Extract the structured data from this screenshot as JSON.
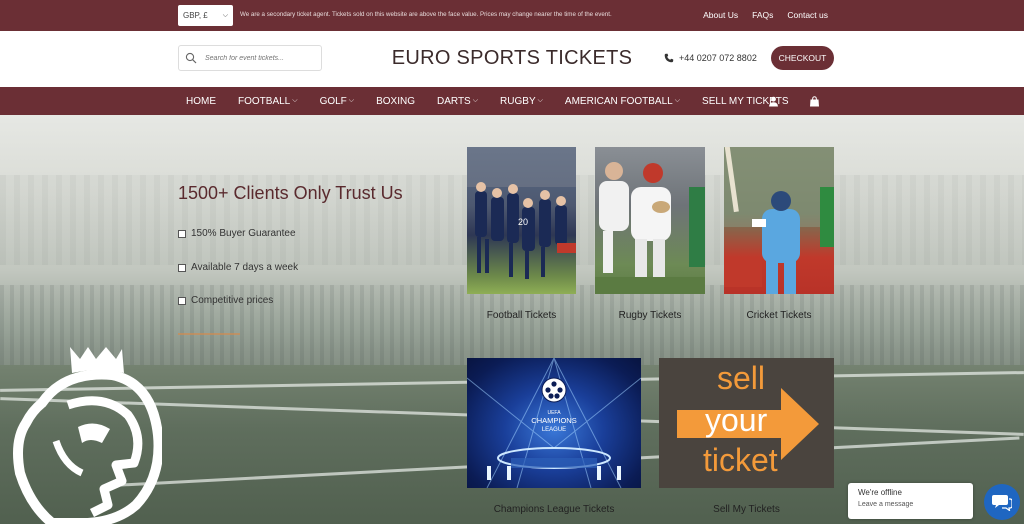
{
  "topbar": {
    "currency": "GBP, £",
    "notice": "We are a secondary ticket agent. Tickets sold on this website are above the face value. Prices may change nearer the time of the event.",
    "links": [
      "About Us",
      "FAQs",
      "Contact us"
    ]
  },
  "header": {
    "search_placeholder": "Search for event tickets...",
    "brand": "EURO SPORTS TICKETS",
    "phone": "+44 0207 072 8802",
    "checkout": "CHECKOUT"
  },
  "nav": {
    "items": [
      {
        "label": "HOME",
        "dropdown": false
      },
      {
        "label": "FOOTBALL",
        "dropdown": true
      },
      {
        "label": "GOLF",
        "dropdown": true
      },
      {
        "label": "BOXING",
        "dropdown": false
      },
      {
        "label": "DARTS",
        "dropdown": true
      },
      {
        "label": "RUGBY",
        "dropdown": true
      },
      {
        "label": "AMERICAN FOOTBALL",
        "dropdown": true
      },
      {
        "label": "SELL MY TICKETS",
        "dropdown": false
      }
    ],
    "icons": [
      "user-icon",
      "shopping-bag-icon"
    ]
  },
  "hero": {
    "title": "1500+ Clients Only Trust Us",
    "bullets": [
      "150% Buyer Guarantee",
      "Available 7 days a week",
      "Competitive prices"
    ]
  },
  "cards": [
    {
      "label": "Football Tickets"
    },
    {
      "label": "Rugby Tickets"
    },
    {
      "label": "Cricket Tickets"
    },
    {
      "label": "Champions League Tickets",
      "logo_text": "UEFA CHAMPIONS LEAGUE"
    },
    {
      "label": "Sell My Tickets",
      "words": [
        "sell",
        "your",
        "ticket"
      ]
    }
  ],
  "chat": {
    "status": "We're offline",
    "prompt": "Leave a message"
  },
  "colors": {
    "brand": "#6b2f35",
    "accent_orange": "#f39a3a",
    "chat_blue": "#1f66c1"
  }
}
